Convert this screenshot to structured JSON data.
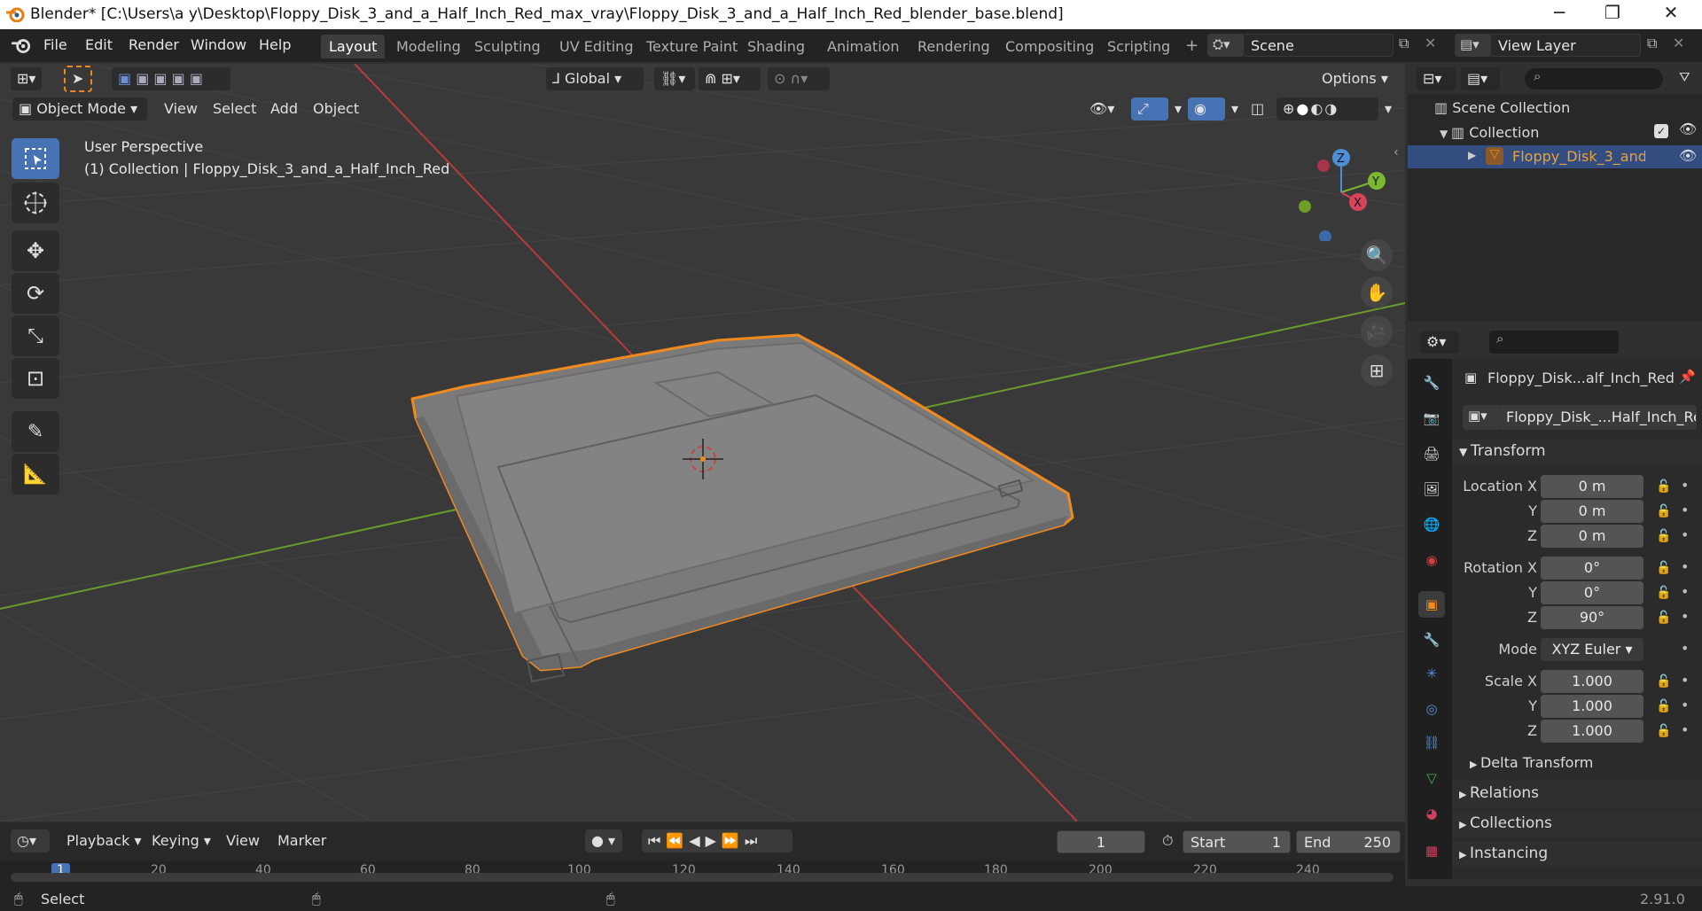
{
  "titlebar": {
    "title": "Blender* [C:\\Users\\a y\\Desktop\\Floppy_Disk_3_and_a_Half_Inch_Red_max_vray\\Floppy_Disk_3_and_a_Half_Inch_Red_blender_base.blend]",
    "minimize": "─",
    "maximize": "❐",
    "close": "✕"
  },
  "menu": {
    "file": "File",
    "edit": "Edit",
    "render": "Render",
    "window": "Window",
    "help": "Help"
  },
  "workspaces": [
    "Layout",
    "Modeling",
    "Sculpting",
    "UV Editing",
    "Texture Paint",
    "Shading",
    "Animation",
    "Rendering",
    "Compositing",
    "Scripting"
  ],
  "scene": "Scene",
  "view_layer": "View Layer",
  "viewport": {
    "transform_orientation": "Global",
    "options": "Options",
    "mode": "Object Mode",
    "menus": [
      "View",
      "Select",
      "Add",
      "Object"
    ],
    "overlay_line1": "User Perspective",
    "overlay_line2": "(1) Collection | Floppy_Disk_3_and_a_Half_Inch_Red",
    "gizmo": {
      "x": "X",
      "y": "Y",
      "z": "Z"
    }
  },
  "outliner": {
    "scene_collection": "Scene Collection",
    "collection": "Collection",
    "object": "Floppy_Disk_3_and_a"
  },
  "properties": {
    "object_name": "Floppy_Disk...alf_Inch_Red",
    "object_field": "Floppy_Disk_...Half_Inch_Red",
    "transform": "Transform",
    "location_label": "Location X",
    "y_label": "Y",
    "z_label": "Z",
    "location": [
      "0 m",
      "0 m",
      "0 m"
    ],
    "rotation_label": "Rotation X",
    "rotation": [
      "0°",
      "0°",
      "90°"
    ],
    "mode_label": "Mode",
    "mode": "XYZ Euler",
    "scale_label": "Scale X",
    "scale": [
      "1.000",
      "1.000",
      "1.000"
    ],
    "delta": "Delta Transform",
    "relations": "Relations",
    "collections": "Collections",
    "instancing": "Instancing"
  },
  "timeline": {
    "playback": "Playback",
    "keying": "Keying",
    "view": "View",
    "marker": "Marker",
    "current_frame": "1",
    "start_label": "Start",
    "start": "1",
    "end_label": "End",
    "end": "250",
    "ticks": [
      "1",
      "20",
      "40",
      "60",
      "80",
      "100",
      "120",
      "140",
      "160",
      "180",
      "200",
      "220",
      "240"
    ]
  },
  "status": {
    "select": "Select",
    "version": "2.91.0"
  },
  "colors": {
    "accent": "#4772b3",
    "selection": "#f08a1f",
    "x_axis": "#b83b3b",
    "y_axis": "#6b9a2d"
  }
}
